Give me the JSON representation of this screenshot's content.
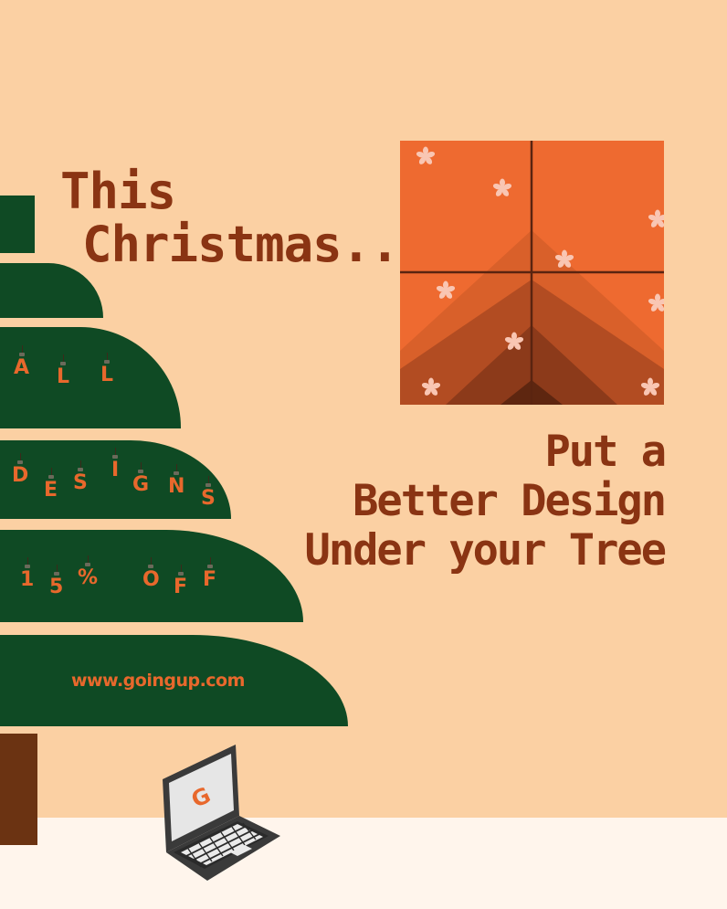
{
  "headline": {
    "line1": "This",
    "line2": "Christmas..."
  },
  "tagline": {
    "line1": "Put a",
    "line2": "Better Design",
    "line3": "Under your Tree"
  },
  "tree": {
    "row1": [
      "A",
      "L",
      "L"
    ],
    "row2": [
      "D",
      "E",
      "S",
      "I",
      "G",
      "N",
      "S"
    ],
    "row3": [
      "1",
      "5",
      "%",
      "O",
      "F",
      "F"
    ],
    "url": "www.goingup.com"
  },
  "laptop": {
    "screen_logo": "G"
  },
  "colors": {
    "background": "#fbd0a3",
    "floor": "#fff5ec",
    "tree": "#0f4a24",
    "trunk": "#6b3312",
    "text_brown": "#8a3413",
    "ornament_orange": "#e8682c",
    "window_orange": "#ee6a30",
    "snow_pink": "#f9c6b3"
  },
  "icons": [
    "snowflake-icon",
    "laptop-icon",
    "logo-g-icon"
  ]
}
